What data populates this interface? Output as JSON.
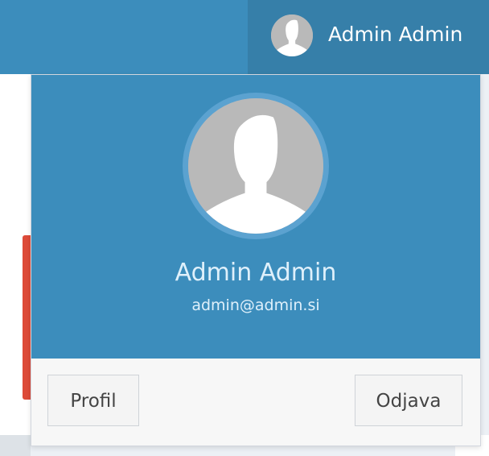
{
  "header": {
    "user_name": "Admin Admin"
  },
  "user_dropdown": {
    "full_name": "Admin Admin",
    "email": "admin@admin.si",
    "profile_button": "Profil",
    "logout_button": "Odjava"
  },
  "icons": {
    "avatar_small": "user-avatar-icon",
    "avatar_large": "user-avatar-icon"
  },
  "colors": {
    "header_bg": "#3c8dbc",
    "header_active_bg": "#367fa9",
    "alert": "#dd4b39"
  }
}
